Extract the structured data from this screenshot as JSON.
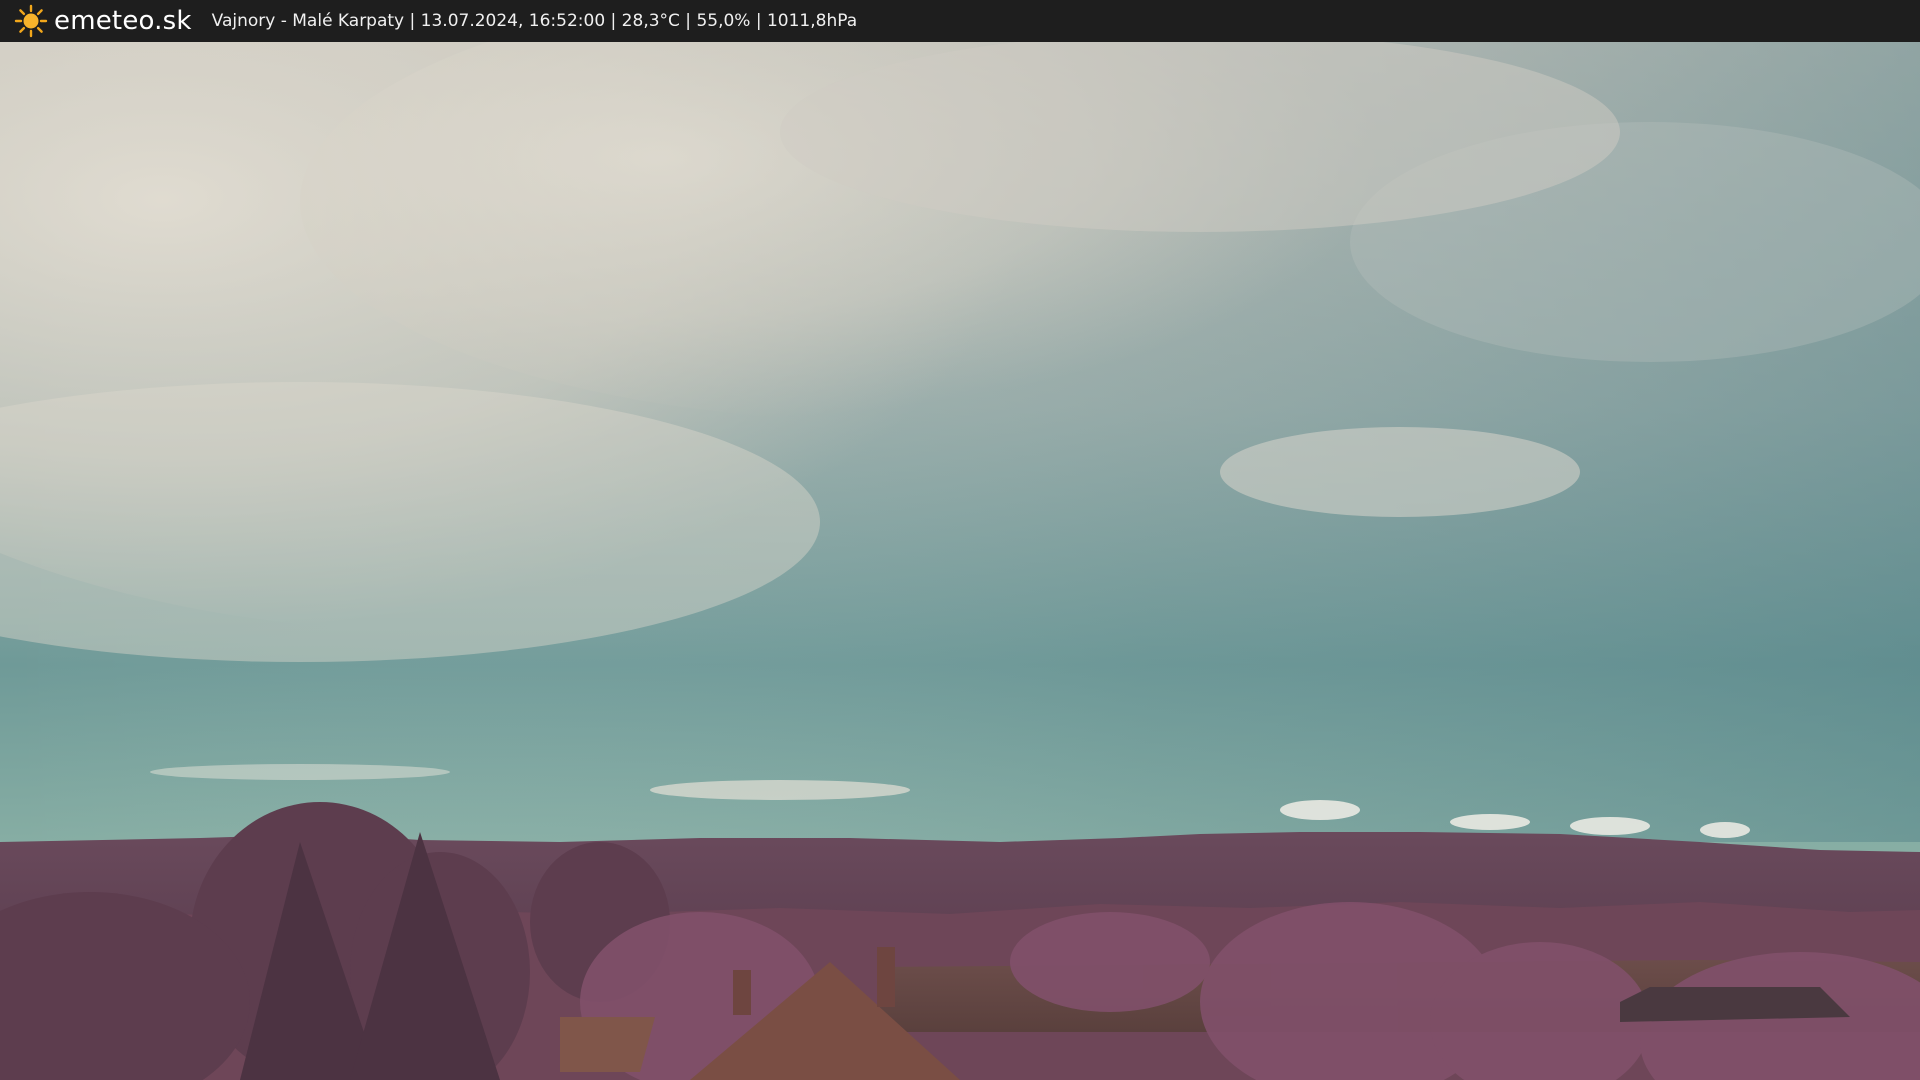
{
  "logo": {
    "text": "emeteo.sk",
    "icon": "sun-icon"
  },
  "caption": "Vajnory - Malé Karpaty | 13.07.2024, 16:52:00 | 28,3°C | 55,0% | 1011,8hPa",
  "colors": {
    "bar": "#1e1e1e",
    "sun": "#f2a71b",
    "sky_top": "#c9c6bd",
    "sky_mid": "#6f9c9a",
    "sky_horizon": "#8fb3a8",
    "hills": "#5e3f52",
    "trees": "#7a4a5e"
  }
}
